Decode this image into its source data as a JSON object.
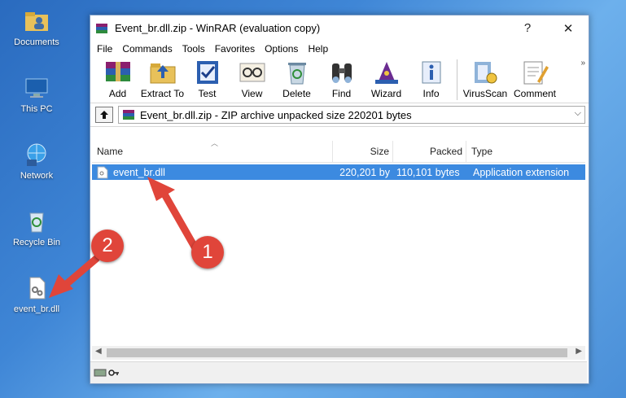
{
  "desktop": {
    "icons": [
      {
        "label": "Documents"
      },
      {
        "label": "This PC"
      },
      {
        "label": "Network"
      },
      {
        "label": "Recycle Bin"
      },
      {
        "label": "event_br.dll"
      }
    ]
  },
  "window": {
    "title": "Event_br.dll.zip - WinRAR (evaluation copy)",
    "help_glyph": "?",
    "close_glyph": "✕"
  },
  "menu": [
    "File",
    "Commands",
    "Tools",
    "Favorites",
    "Options",
    "Help"
  ],
  "toolbar": {
    "buttons": [
      "Add",
      "Extract To",
      "Test",
      "View",
      "Delete",
      "Find",
      "Wizard",
      "Info",
      "VirusScan",
      "Comment"
    ],
    "more": "»"
  },
  "address": {
    "path": "Event_br.dll.zip - ZIP archive unpacked size 220201 bytes"
  },
  "file_list": {
    "columns": [
      "Name",
      "Size",
      "Packed",
      "Type"
    ],
    "rows": [
      {
        "name": "event_br.dll",
        "size": "220,201 by",
        "packed": "110,101 bytes",
        "type": "Application extension"
      }
    ]
  },
  "annotations": {
    "badge1": "1",
    "badge2": "2",
    "color": "#e0453a"
  }
}
